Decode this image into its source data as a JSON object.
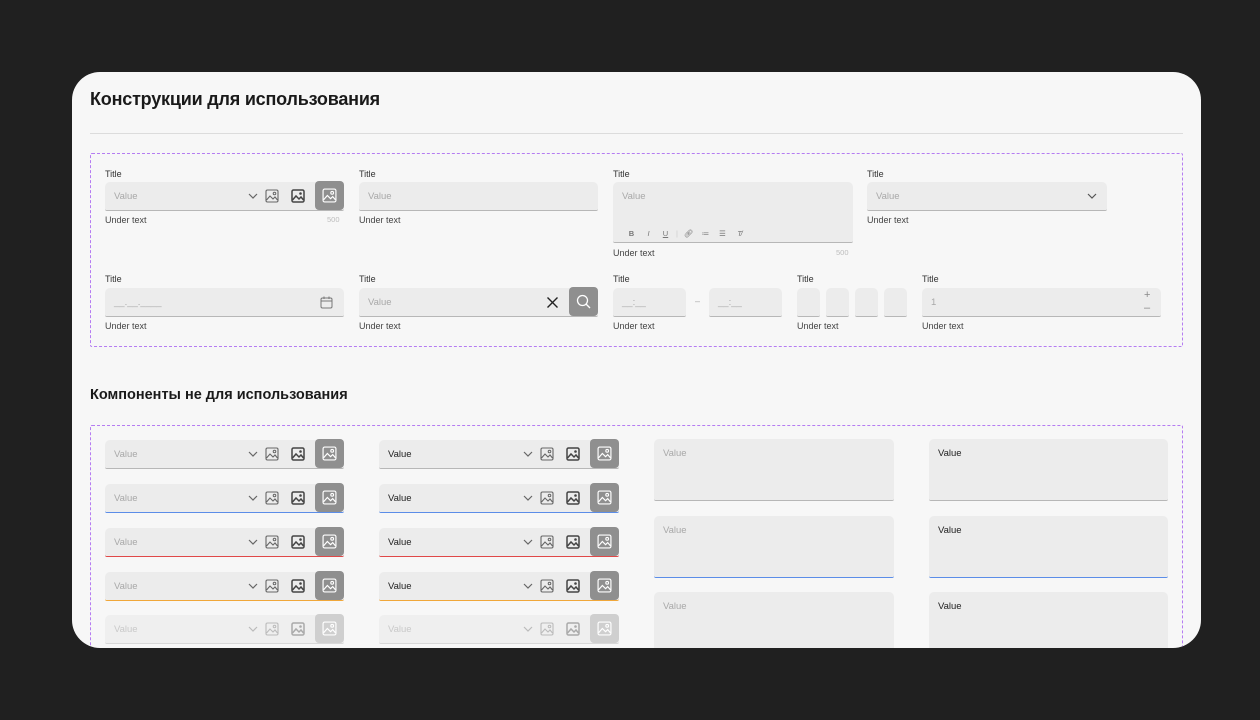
{
  "section1": {
    "title": "Конструкции для использования"
  },
  "section2": {
    "title": "Компоненты не для использования"
  },
  "row1": {
    "select_icons": {
      "title": "Title",
      "value": "Value",
      "under": "Under text",
      "counter": "500"
    },
    "input": {
      "title": "Title",
      "value": "Value",
      "under": "Under text"
    },
    "textarea": {
      "title": "Title",
      "value": "Value",
      "under": "Under text",
      "counter": "500",
      "toolbar": [
        "B",
        "I",
        "U",
        "link",
        "ordered-list",
        "bullet-list",
        "clear-format"
      ]
    },
    "select": {
      "title": "Title",
      "value": "Value",
      "under": "Under text"
    }
  },
  "row2": {
    "date": {
      "title": "Title",
      "value": "__.__.____",
      "under": "Under text"
    },
    "search": {
      "title": "Title",
      "value": "Value",
      "under": "Under text"
    },
    "time_range": {
      "title": "Title",
      "from": "__:__",
      "separator": "–",
      "to": "__:__",
      "under": "Under text"
    },
    "code": {
      "title": "Title",
      "under": "Under text",
      "cells": 4
    },
    "number": {
      "title": "Title",
      "value": "1",
      "plus": "+",
      "minus": "–",
      "under": "Under text"
    }
  },
  "components": {
    "placeholder_value": "Value",
    "states": [
      "default",
      "focus",
      "error",
      "warning",
      "disabled"
    ],
    "colors": {
      "focus": "#5b8de8",
      "error": "#e04848",
      "warning": "#f0a73a",
      "accent": "#b57cf2"
    }
  },
  "icons": {
    "chevron": "chevron-down-icon",
    "image": "image-icon",
    "calendar": "calendar-icon",
    "clear": "close-icon",
    "search": "search-icon"
  }
}
